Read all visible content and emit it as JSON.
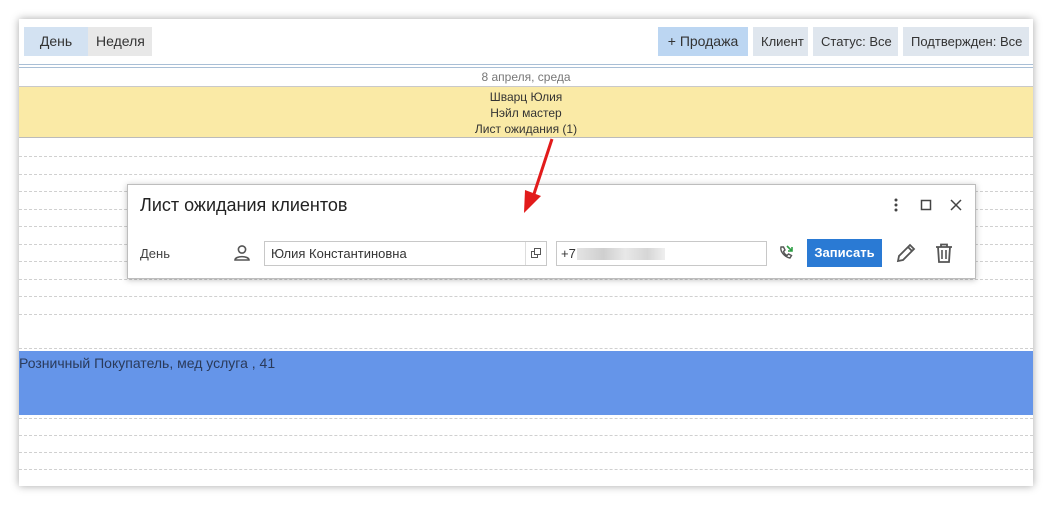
{
  "toolbar": {
    "day_label": "День",
    "week_label": "Неделя",
    "sale_label": "+ Продажа",
    "client_label": "Клиент",
    "status_label": "Статус: Все",
    "confirmed_label": "Подтвержден: Все"
  },
  "calendar": {
    "date": "8 апреля, среда",
    "master": {
      "name": "Шварц Юлия",
      "role": "Нэйл мастер",
      "waitlist": "Лист ожидания (1)"
    },
    "booking_text": "Розничный Покупатель, мед услуга , 41"
  },
  "dialog": {
    "title": "Лист ожидания клиентов",
    "day_label": "День",
    "client_value": "Юлия Константиновна",
    "phone_value": "+7",
    "submit_label": "Записать",
    "icons": {
      "more": "more-vert-icon",
      "maximize": "maximize-icon",
      "close": "close-icon",
      "person": "person-icon",
      "open": "open-window-icon",
      "call": "phone-callback-icon",
      "edit": "pencil-icon",
      "delete": "trash-icon"
    }
  },
  "colors": {
    "accent_button": "#2a7ad4",
    "master_bg": "#faeaa6",
    "booking_bg": "#6595e9",
    "annotation_arrow": "#e21b1b"
  }
}
